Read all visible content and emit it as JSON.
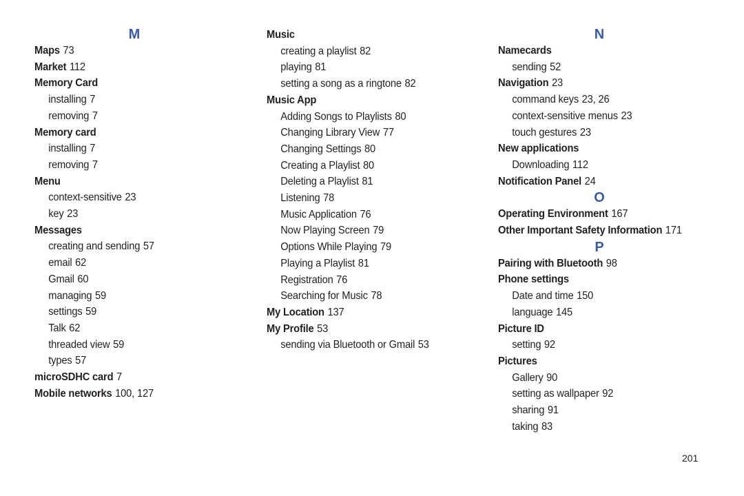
{
  "page_number": "201",
  "accent_color": "#3a5ba9",
  "columns": [
    {
      "sections": [
        {
          "letter": "M",
          "entries": [
            {
              "term": "Maps",
              "pages": "73",
              "subs": []
            },
            {
              "term": "Market",
              "pages": "112",
              "subs": []
            },
            {
              "term": "Memory Card",
              "pages": "",
              "subs": [
                {
                  "term": "installing",
                  "pages": "7"
                },
                {
                  "term": "removing",
                  "pages": "7"
                }
              ]
            },
            {
              "term": "Memory card",
              "pages": "",
              "subs": [
                {
                  "term": "installing",
                  "pages": "7"
                },
                {
                  "term": "removing",
                  "pages": "7"
                }
              ]
            },
            {
              "term": "Menu",
              "pages": "",
              "subs": [
                {
                  "term": "context-sensitive",
                  "pages": "23"
                },
                {
                  "term": "key",
                  "pages": "23"
                }
              ]
            },
            {
              "term": "Messages",
              "pages": "",
              "subs": [
                {
                  "term": "creating and sending",
                  "pages": "57"
                },
                {
                  "term": "email",
                  "pages": "62"
                },
                {
                  "term": "Gmail",
                  "pages": "60"
                },
                {
                  "term": "managing",
                  "pages": "59"
                },
                {
                  "term": "settings",
                  "pages": "59"
                },
                {
                  "term": "Talk",
                  "pages": "62"
                },
                {
                  "term": "threaded view",
                  "pages": "59"
                },
                {
                  "term": "types",
                  "pages": "57"
                }
              ]
            },
            {
              "term": "microSDHC card",
              "pages": "7",
              "subs": []
            },
            {
              "term": "Mobile networks",
              "pages": "100, 127",
              "subs": []
            }
          ]
        }
      ]
    },
    {
      "sections": [
        {
          "letter": "",
          "entries": [
            {
              "term": "Music",
              "pages": "",
              "subs": [
                {
                  "term": "creating a playlist",
                  "pages": "82"
                },
                {
                  "term": "playing",
                  "pages": "81"
                },
                {
                  "term": "setting a song as a ringtone",
                  "pages": "82"
                }
              ]
            },
            {
              "term": "Music App",
              "pages": "",
              "subs": [
                {
                  "term": "Adding Songs to Playlists",
                  "pages": "80"
                },
                {
                  "term": "Changing Library View",
                  "pages": "77"
                },
                {
                  "term": "Changing Settings",
                  "pages": "80"
                },
                {
                  "term": "Creating a Playlist",
                  "pages": "80"
                },
                {
                  "term": "Deleting a Playlist",
                  "pages": "81"
                },
                {
                  "term": "Listening",
                  "pages": "78"
                },
                {
                  "term": "Music Application",
                  "pages": "76"
                },
                {
                  "term": "Now Playing Screen",
                  "pages": "79"
                },
                {
                  "term": "Options While Playing",
                  "pages": "79"
                },
                {
                  "term": "Playing a Playlist",
                  "pages": "81"
                },
                {
                  "term": "Registration",
                  "pages": "76"
                },
                {
                  "term": "Searching for Music",
                  "pages": "78"
                }
              ]
            },
            {
              "term": "My Location",
              "pages": "137",
              "subs": []
            },
            {
              "term": "My Profile",
              "pages": "53",
              "subs": [
                {
                  "term": "sending via Bluetooth or Gmail",
                  "pages": "53"
                }
              ]
            }
          ]
        }
      ]
    },
    {
      "sections": [
        {
          "letter": "N",
          "entries": [
            {
              "term": "Namecards",
              "pages": "",
              "subs": [
                {
                  "term": "sending",
                  "pages": "52"
                }
              ]
            },
            {
              "term": "Navigation",
              "pages": "23",
              "subs": [
                {
                  "term": "command keys",
                  "pages": "23, 26"
                },
                {
                  "term": "context-sensitive menus",
                  "pages": "23"
                },
                {
                  "term": "touch gestures",
                  "pages": "23"
                }
              ]
            },
            {
              "term": "New applications",
              "pages": "",
              "subs": [
                {
                  "term": "Downloading",
                  "pages": "112"
                }
              ]
            },
            {
              "term": "Notification Panel",
              "pages": "24",
              "subs": []
            }
          ]
        },
        {
          "letter": "O",
          "entries": [
            {
              "term": "Operating Environment",
              "pages": "167",
              "subs": []
            },
            {
              "term": "Other Important Safety Information",
              "pages": "171",
              "subs": []
            }
          ]
        },
        {
          "letter": "P",
          "entries": [
            {
              "term": "Pairing with Bluetooth",
              "pages": "98",
              "subs": []
            },
            {
              "term": "Phone settings",
              "pages": "",
              "subs": [
                {
                  "term": "Date and time",
                  "pages": "150"
                },
                {
                  "term": "language",
                  "pages": "145"
                }
              ]
            },
            {
              "term": "Picture ID",
              "pages": "",
              "subs": [
                {
                  "term": "setting",
                  "pages": "92"
                }
              ]
            },
            {
              "term": "Pictures",
              "pages": "",
              "subs": [
                {
                  "term": "Gallery",
                  "pages": "90"
                },
                {
                  "term": "setting as wallpaper",
                  "pages": "92"
                },
                {
                  "term": "sharing",
                  "pages": "91"
                },
                {
                  "term": "taking",
                  "pages": "83"
                }
              ]
            }
          ]
        }
      ]
    }
  ]
}
